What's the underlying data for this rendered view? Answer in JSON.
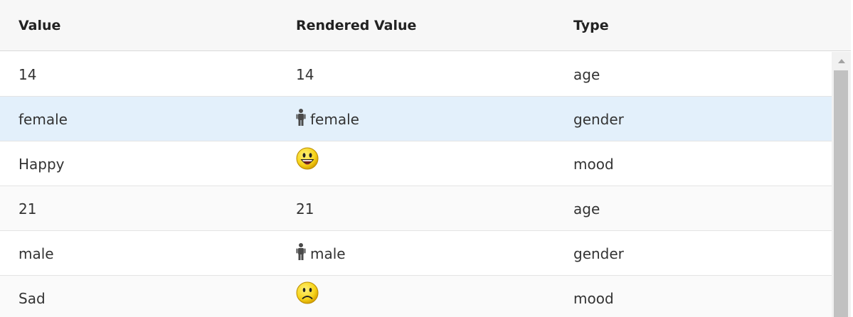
{
  "columns": {
    "value": "Value",
    "rendered": "Rendered Value",
    "type": "Type"
  },
  "rows": [
    {
      "value": "14",
      "rendered": "14",
      "rendered_icon": "",
      "type": "age",
      "selected": false
    },
    {
      "value": "female",
      "rendered": "female",
      "rendered_icon": "person-icon",
      "type": "gender",
      "selected": true
    },
    {
      "value": "Happy",
      "rendered": "",
      "rendered_icon": "happy-face-icon",
      "type": "mood",
      "selected": false
    },
    {
      "value": "21",
      "rendered": "21",
      "rendered_icon": "",
      "type": "age",
      "selected": false
    },
    {
      "value": "male",
      "rendered": "male",
      "rendered_icon": "person-icon",
      "type": "gender",
      "selected": false
    },
    {
      "value": "Sad",
      "rendered": "",
      "rendered_icon": "sad-face-icon",
      "type": "mood",
      "selected": false
    }
  ],
  "colors": {
    "header_bg": "#f7f7f7",
    "selected_row_bg": "#e3f0fb",
    "smiley_fill": "#f6d31a",
    "scroll_thumb": "#c1c1c1"
  }
}
